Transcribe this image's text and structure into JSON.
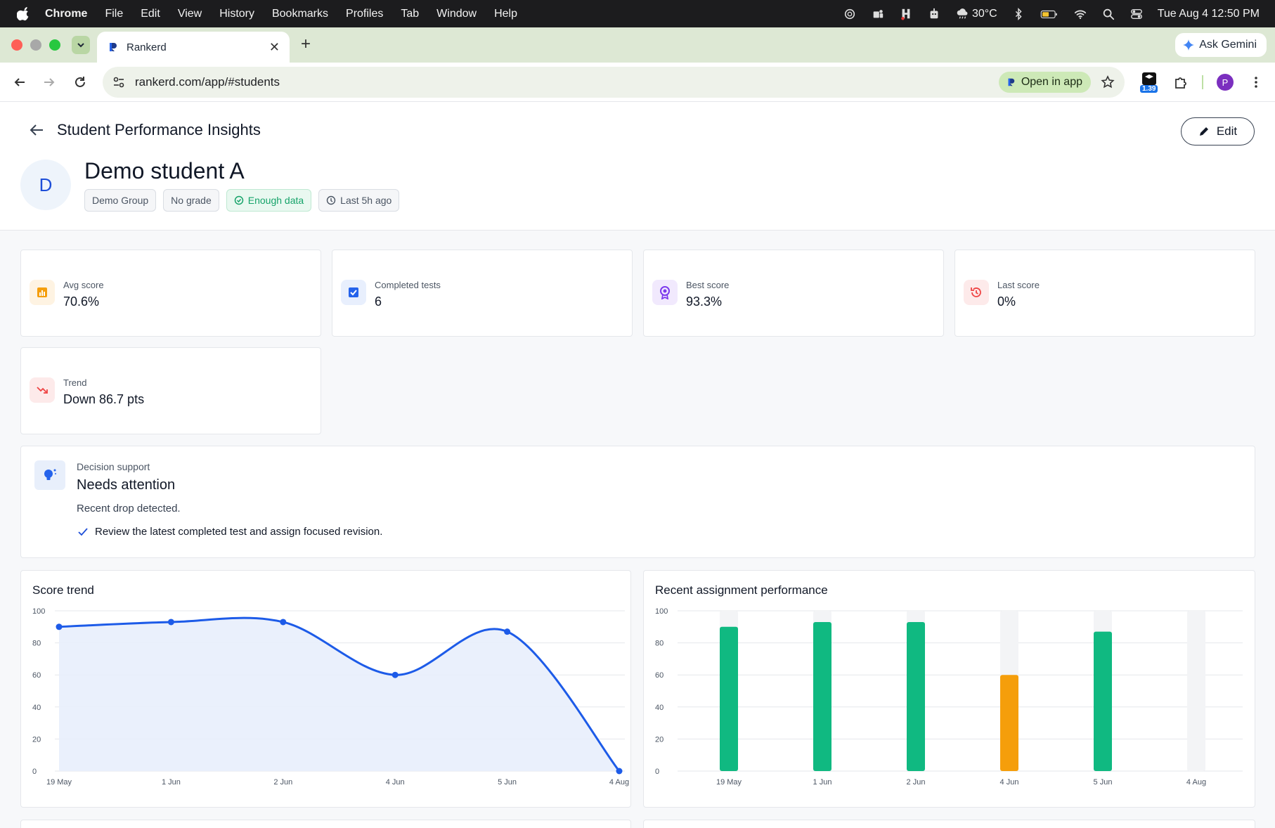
{
  "menubar": {
    "app_name": "Chrome",
    "items": [
      "File",
      "Edit",
      "View",
      "History",
      "Bookmarks",
      "Profiles",
      "Tab",
      "Window",
      "Help"
    ],
    "weather": "30°C",
    "datetime": "Tue Aug 4  12:50 PM"
  },
  "browser": {
    "tab_title": "Rankerd",
    "url": "rankerd.com/app/#students",
    "open_in_app": "Open in app",
    "ask_gemini": "Ask Gemini",
    "extension_badge": "1.39",
    "profile_initial": "P"
  },
  "header": {
    "title": "Student Performance Insights",
    "edit_label": "Edit",
    "avatar_initial": "D",
    "student_name": "Demo student A",
    "chips": {
      "group": "Demo Group",
      "grade": "No grade",
      "data_status": "Enough data",
      "last_seen": "Last 5h ago"
    }
  },
  "stats": {
    "avg": {
      "label": "Avg score",
      "value": "70.6%",
      "icon": "bar-chart-icon",
      "color": "#f59e0b"
    },
    "completed": {
      "label": "Completed tests",
      "value": "6",
      "icon": "checkbox-icon",
      "color": "#2563eb"
    },
    "best": {
      "label": "Best score",
      "value": "93.3%",
      "icon": "award-icon",
      "color": "#7c3aed"
    },
    "last": {
      "label": "Last score",
      "value": "0%",
      "icon": "history-icon",
      "color": "#ef4444"
    },
    "trend": {
      "label": "Trend",
      "value": "Down 86.7 pts",
      "icon": "trending-down-icon",
      "color": "#ef4444"
    }
  },
  "decision": {
    "label": "Decision support",
    "title": "Needs attention",
    "description": "Recent drop detected.",
    "action": "Review the latest completed test and assign focused revision."
  },
  "chart_data": [
    {
      "type": "area",
      "title": "Score trend",
      "categories": [
        "19 May",
        "1 Jun",
        "2 Jun",
        "4 Jun",
        "5 Jun",
        "4 Aug"
      ],
      "values": [
        90,
        93,
        93,
        60,
        87,
        0
      ],
      "ylim": [
        0,
        100
      ],
      "yticks": [
        "100",
        "80",
        "60",
        "40",
        "20",
        "0"
      ],
      "grid": true,
      "color": "#1d5be8"
    },
    {
      "type": "bar",
      "title": "Recent assignment performance",
      "categories": [
        "19 May",
        "1 Jun",
        "2 Jun",
        "4 Jun",
        "5 Jun",
        "4 Aug"
      ],
      "values": [
        90,
        93,
        93,
        60,
        87,
        0
      ],
      "ylim": [
        0,
        100
      ],
      "yticks": [
        "100",
        "80",
        "60",
        "40",
        "20",
        "0"
      ],
      "grid": true,
      "colors": [
        "#10b981",
        "#10b981",
        "#10b981",
        "#f59e0b",
        "#10b981",
        "#10b981"
      ]
    }
  ]
}
